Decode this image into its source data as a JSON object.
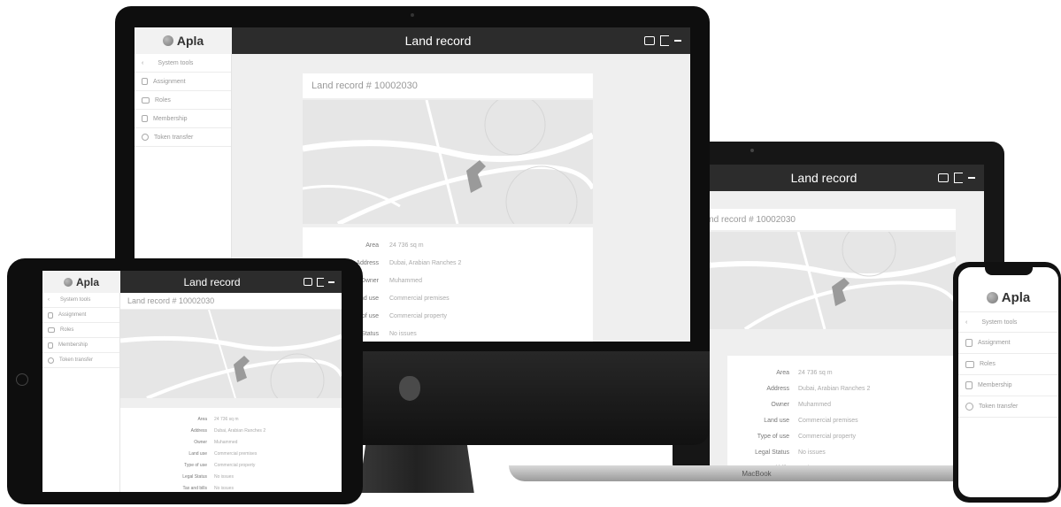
{
  "app": {
    "title": "Land record",
    "brand": "Apla"
  },
  "card": {
    "heading": "Land record # 10002030"
  },
  "sidebar": {
    "back_label": "System tools",
    "items": [
      {
        "label": "Assignment",
        "icon": "user-icon"
      },
      {
        "label": "Roles",
        "icon": "roles-icon"
      },
      {
        "label": "Membership",
        "icon": "user-icon"
      },
      {
        "label": "Token transfer",
        "icon": "token-icon"
      }
    ]
  },
  "record": {
    "fields": [
      {
        "label": "Area",
        "value": "24 736 sq m"
      },
      {
        "label": "Address",
        "value": "Dubai, Arabian Ranches 2"
      },
      {
        "label": "Owner",
        "value": "Muhammed"
      },
      {
        "label": "Land use",
        "value": "Commercial premises"
      },
      {
        "label": "Type of use",
        "value": "Commercial property"
      },
      {
        "label": "Legal Status",
        "value": "No issues"
      },
      {
        "label": "Tax and bills",
        "value": "No issues"
      }
    ]
  },
  "laptop": {
    "brand_label": "MacBook"
  },
  "colors": {
    "topbar": "#2c2c2c",
    "content_bg": "#efefef",
    "device_frame": "#0e0e0e",
    "map_bg": "#e6e6e6",
    "parcel": "#9a9a9a"
  }
}
